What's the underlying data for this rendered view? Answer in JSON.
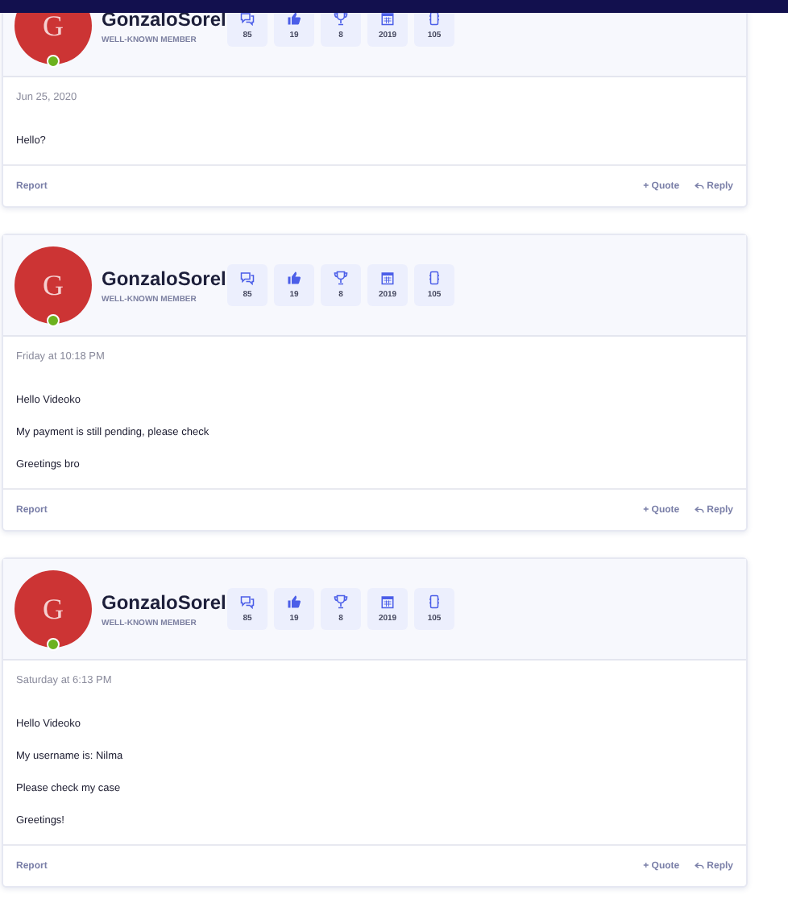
{
  "posts": [
    {
      "author": {
        "initial": "G",
        "name": "GonzaloSorel",
        "title": "WELL-KNOWN MEMBER",
        "online": true
      },
      "stats": [
        {
          "kind": "messages",
          "value": "85"
        },
        {
          "kind": "likes",
          "value": "19"
        },
        {
          "kind": "trophies",
          "value": "8"
        },
        {
          "kind": "joined",
          "value": "2019"
        },
        {
          "kind": "device",
          "value": "105"
        }
      ],
      "date": "Jun 25, 2020",
      "lines": [
        "Hello?"
      ],
      "actions": {
        "report": "Report",
        "quote": "+ Quote",
        "reply": "Reply"
      }
    },
    {
      "author": {
        "initial": "G",
        "name": "GonzaloSorel",
        "title": "WELL-KNOWN MEMBER",
        "online": true
      },
      "stats": [
        {
          "kind": "messages",
          "value": "85"
        },
        {
          "kind": "likes",
          "value": "19"
        },
        {
          "kind": "trophies",
          "value": "8"
        },
        {
          "kind": "joined",
          "value": "2019"
        },
        {
          "kind": "device",
          "value": "105"
        }
      ],
      "date": "Friday at 10:18 PM",
      "lines": [
        "Hello Videoko",
        "My payment is still pending, please check",
        "Greetings bro"
      ],
      "actions": {
        "report": "Report",
        "quote": "+ Quote",
        "reply": "Reply"
      }
    },
    {
      "author": {
        "initial": "G",
        "name": "GonzaloSorel",
        "title": "WELL-KNOWN MEMBER",
        "online": true
      },
      "stats": [
        {
          "kind": "messages",
          "value": "85"
        },
        {
          "kind": "likes",
          "value": "19"
        },
        {
          "kind": "trophies",
          "value": "8"
        },
        {
          "kind": "joined",
          "value": "2019"
        },
        {
          "kind": "device",
          "value": "105"
        }
      ],
      "date": "Saturday at 6:13 PM",
      "lines": [
        "Hello Videoko",
        "My username is: Nilma",
        "Please check my case",
        "Greetings!"
      ],
      "actions": {
        "report": "Report",
        "quote": "+ Quote",
        "reply": "Reply"
      }
    }
  ]
}
